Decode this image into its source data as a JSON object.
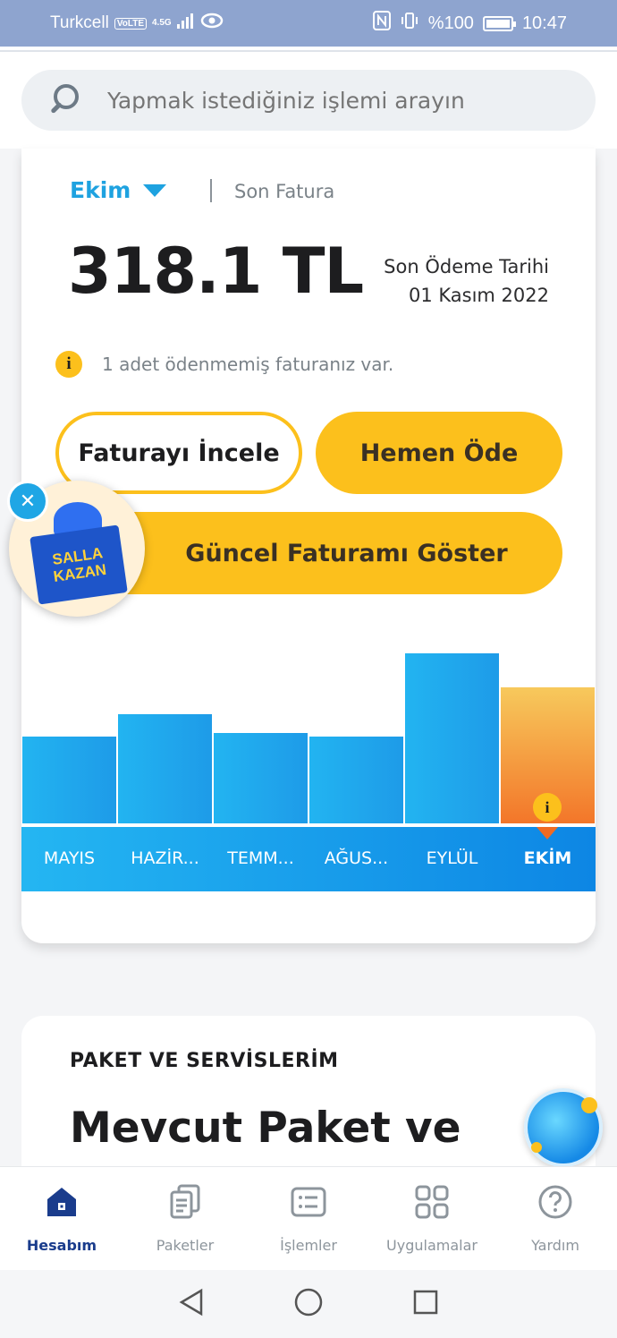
{
  "status_bar": {
    "carrier": "Turkcell",
    "volte": "VoLTE",
    "network": "4.5G",
    "battery": "%100",
    "time": "10:47"
  },
  "search": {
    "placeholder": "Yapmak istediğiniz işlemi arayın"
  },
  "bill": {
    "month": "Ekim",
    "last_bill_label": "Son Fatura",
    "amount": "318.1 TL",
    "due_label": "Son Ödeme Tarihi",
    "due_date": "01 Kasım 2022",
    "info_text": "1 adet ödenmemiş faturanız var.",
    "review_button": "Faturayı İncele",
    "pay_button": "Hemen Öde",
    "current_bill_button": "Güncel Faturamı Göster"
  },
  "promo": {
    "line1": "SALLA",
    "line2": "KAZAN"
  },
  "chart_data": {
    "type": "bar",
    "categories": [
      "MAYIS",
      "HAZİR...",
      "TEMM...",
      "AĞUS...",
      "EYLÜL",
      "EKİM"
    ],
    "values": [
      0.56,
      0.68,
      0.58,
      0.56,
      1.0,
      0.82
    ],
    "selected": "EKİM",
    "colors": {
      "bar": "#1e9be8",
      "selected_top": "#f7c95c",
      "selected_bottom": "#f26a22"
    }
  },
  "packages": {
    "section_title": "PAKET VE SERVİSLERİM",
    "heading": "Mevcut Paket ve"
  },
  "bottom_nav": [
    {
      "label": "Hesabım",
      "icon": "home-icon",
      "active": true
    },
    {
      "label": "Paketler",
      "icon": "packages-icon",
      "active": false
    },
    {
      "label": "İşlemler",
      "icon": "list-icon",
      "active": false
    },
    {
      "label": "Uygulamalar",
      "icon": "apps-grid-icon",
      "active": false
    },
    {
      "label": "Yardım",
      "icon": "help-icon",
      "active": false
    }
  ],
  "colors": {
    "accent": "#fcc01c",
    "brand_blue": "#1ea2e0",
    "nav_active": "#1a3c8c"
  }
}
